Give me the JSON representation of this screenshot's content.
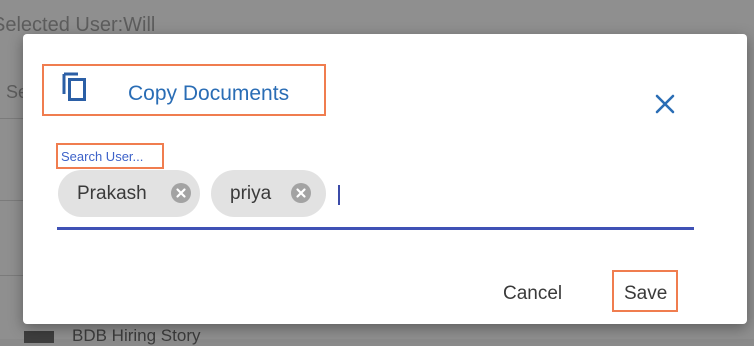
{
  "background": {
    "title": "Selected User:Will",
    "select_label": "Se",
    "document_label": "BDB Hiring Story"
  },
  "dialog": {
    "title": "Copy Documents",
    "title_icon": "copy-icon",
    "close_icon": "close-icon",
    "search_label": "Search User...",
    "selected_users": [
      {
        "label": "Prakash",
        "remove_icon": "cancel-circle-icon"
      },
      {
        "label": "priya",
        "remove_icon": "cancel-circle-icon"
      }
    ],
    "search_value": "",
    "cancel_label": "Cancel",
    "save_label": "Save"
  },
  "colors": {
    "accent": "#3f51b5",
    "title_blue": "#2a6db5",
    "highlight_orange": "#f07d4f",
    "chip_bg": "#e2e2e2"
  }
}
